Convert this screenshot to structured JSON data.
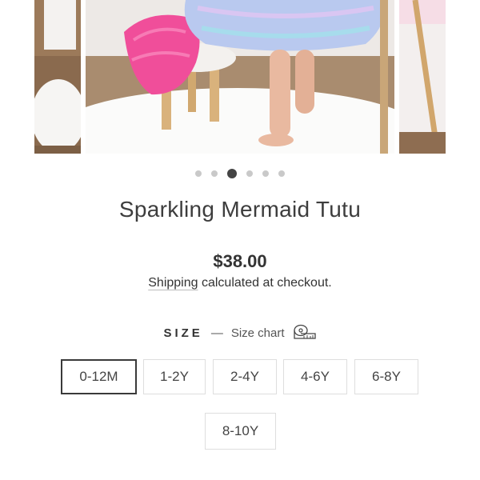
{
  "product": {
    "title": "Sparkling Mermaid Tutu",
    "price": "$38.00",
    "shipping_link": "Shipping",
    "shipping_rest": " calculated at checkout."
  },
  "gallery": {
    "slide_count": 6,
    "active_index": 2,
    "zoom_icon": "magnifier-icon"
  },
  "size": {
    "label": "SIZE",
    "dash": "—",
    "chart_label": "Size chart",
    "chart_icon": "measuring-tape-icon",
    "options": [
      "0-12M",
      "1-2Y",
      "2-4Y",
      "4-6Y",
      "6-8Y",
      "8-10Y"
    ],
    "selected": "0-12M"
  },
  "colors": {
    "text": "#3d3d3d",
    "selected_border": "#3a3a3a",
    "option_border": "#dedede",
    "dot_inactive": "#c9c9c9",
    "dot_active": "#444444"
  }
}
